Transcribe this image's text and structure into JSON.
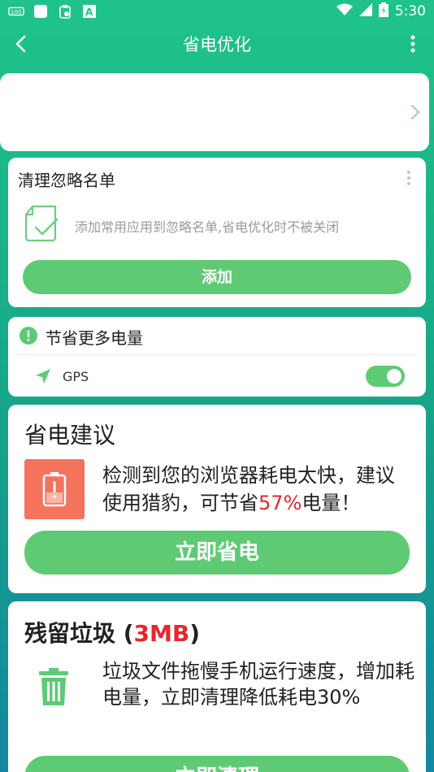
{
  "status_bar": {
    "time": "5:30",
    "icons": [
      "data-saver-icon",
      "square-icon",
      "clipboard-icon",
      "font-icon",
      "wifi-icon",
      "signal-icon",
      "battery-icon"
    ]
  },
  "app_bar": {
    "title": "省电优化"
  },
  "ignore_list": {
    "title": "清理忽略名单",
    "description": "添加常用应用到忽略名单,省电优化时不被关闭",
    "button_label": "添加"
  },
  "save_more": {
    "title": "节省更多电量",
    "gps_label": "GPS",
    "gps_enabled": true
  },
  "suggestion": {
    "title": "省电建议",
    "text_before": "检测到您的浏览器耗电太快，建议使用猎豹，可节省",
    "highlight": "57%",
    "text_after": "电量！",
    "button_label": "立即省电"
  },
  "junk": {
    "title_prefix": "残留垃圾 (",
    "size": "3MB",
    "title_suffix": ")",
    "text": "垃圾文件拖慢手机运行速度，增加耗电量，立即清理降低耗电30%",
    "button_label": "立即清理"
  },
  "colors": {
    "accent_green": "#5ecb74",
    "highlight_red": "#e8252b",
    "battery_box": "#f4735d"
  }
}
